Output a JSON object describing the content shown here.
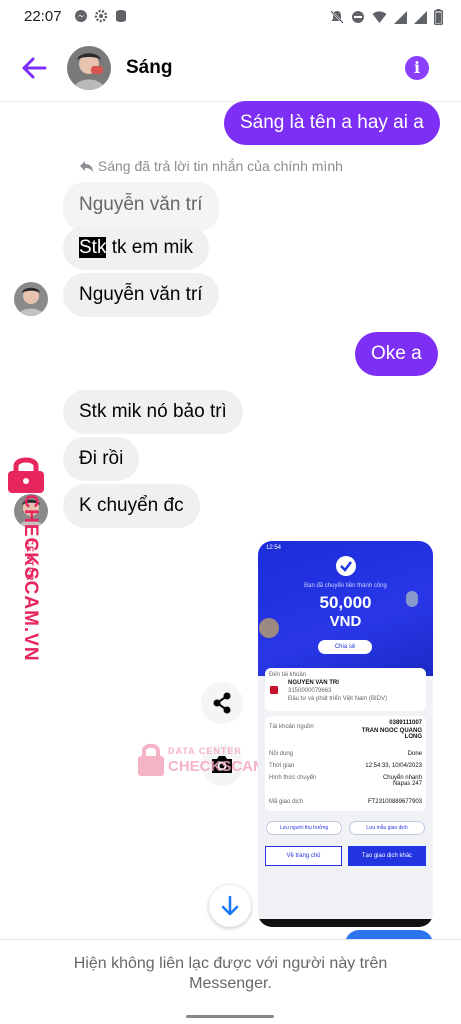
{
  "status": {
    "time": "22:07"
  },
  "header": {
    "contact_name": "Sáng"
  },
  "messages": {
    "m1": "Sáng là tên a hay ai a",
    "reply_note": "Sáng đã trả lời tin nhắn của chính mình",
    "quote": "Nguyễn văn trí",
    "m2_highlight": "Stk",
    "m2_rest": " tk em mik",
    "m3": "Nguyễn văn trí",
    "m4": "Oke a",
    "m5": "Stk mik nó bảo trì",
    "m6": "Đi rồi",
    "m7": "K chuyển đc"
  },
  "receipt": {
    "time": "12:54",
    "success_text": "Bạn đã chuyển tiền thành công",
    "amount": "50,000",
    "currency": "VND",
    "share": "Chia sẻ",
    "to_label": "Đến tài khoản",
    "recipient_name": "NGUYEN VAN TRI",
    "recipient_account": "3150000079663",
    "recipient_bank": "Đầu tư và phát triển Việt Nam (BIDV)",
    "source_label": "Tài khoản nguồn",
    "source_account": "0389111007",
    "sender_name": "TRAN NGOC QUANG LONG",
    "content_label": "Nội dung",
    "content_value": "Done",
    "time_label": "Thời gian",
    "time_value": "12:54:33, 10/04/2023",
    "method_label": "Hình thức chuyển",
    "method_value": "Chuyển nhanh Napas 247",
    "code_label": "Mã giao dịch",
    "code_value": "FT23100889677903",
    "save_recipient": "Lưu người thụ hưởng",
    "save_template": "Lưu mẫu giao dịch",
    "home_btn": "Về trang chủ",
    "new_tx_btn": "Tạo giao dịch khác"
  },
  "watermark": {
    "side_brand": "CHECKSCAM.VN",
    "side_center": "CENTER",
    "center_top": "DATA CENTER",
    "center_bottom": "CHECKSCAM.VN"
  },
  "footer": {
    "notice": "Hiện không liên lạc được với người này trên Messenger."
  },
  "colors": {
    "accent": "#7d2ff6",
    "incoming": "#f0f0f0",
    "receipt_blue": "#2233e0",
    "watermark": "#e8265e"
  }
}
